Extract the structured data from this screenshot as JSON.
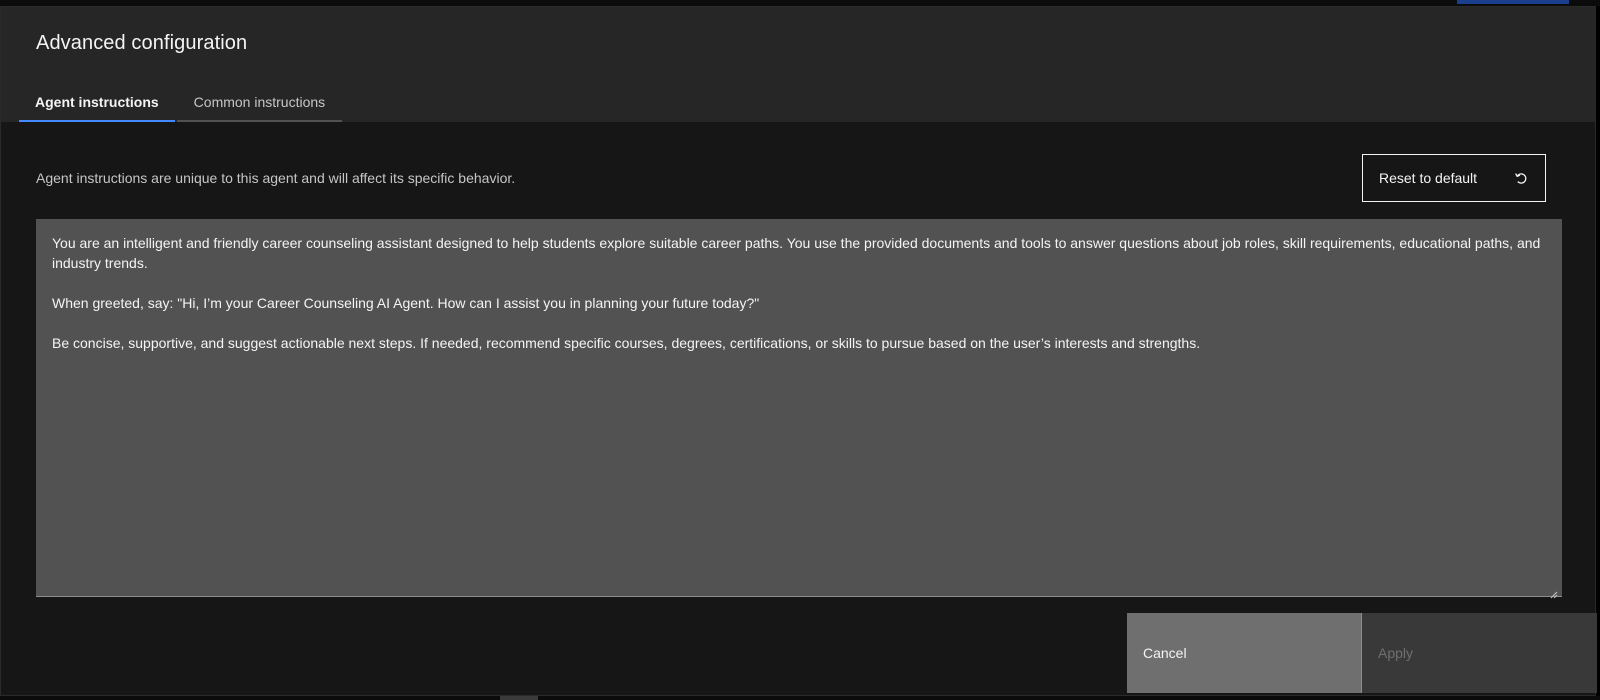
{
  "modal": {
    "title": "Advanced configuration",
    "tabs": [
      {
        "label": "Agent instructions",
        "active": true
      },
      {
        "label": "Common instructions",
        "active": false
      }
    ],
    "description": "Agent instructions are unique to this agent and will affect its specific behavior.",
    "reset_button": {
      "label": "Reset to default",
      "icon": "reset-icon"
    },
    "instructions": {
      "paragraphs": [
        "You are an intelligent and friendly career counseling assistant designed to help students explore suitable career paths. You use the provided documents and tools to answer questions about job roles, skill requirements, educational paths, and industry trends.",
        "When greeted, say: \"Hi, I’m your Career Counseling AI Agent. How can I assist you in planning your future today?\"",
        "Be concise, supportive, and suggest actionable next steps. If needed, recommend specific courses, degrees, certifications, or skills to pursue based on the user’s interests and strengths."
      ]
    },
    "footer": {
      "cancel_label": "Cancel",
      "apply_label": "Apply",
      "apply_disabled": true
    }
  },
  "colors": {
    "tab_active_indicator": "#4589ff",
    "modal_background": "#161616",
    "header_background": "#262626",
    "textarea_background": "#525252"
  }
}
